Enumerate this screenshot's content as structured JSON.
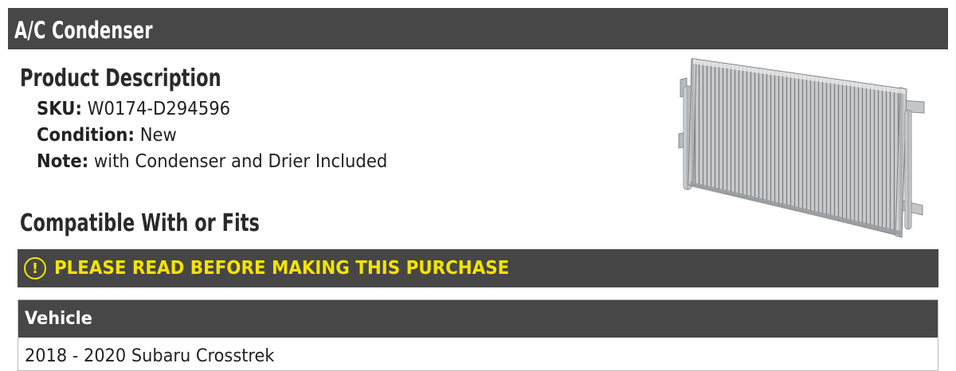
{
  "header": {
    "title": "A/C Condenser"
  },
  "description": {
    "heading": "Product Description",
    "sku_label": "SKU:",
    "sku_value": "W0174-D294596",
    "condition_label": "Condition:",
    "condition_value": "New",
    "note_label": "Note:",
    "note_value": "with Condenser and Drier Included"
  },
  "compatibility": {
    "heading": "Compatible With or Fits",
    "warning_icon": "exclamation-circle-icon",
    "warning_text": "PLEASE READ BEFORE MAKING THIS PURCHASE",
    "warning_color": "#f5e400",
    "table": {
      "column_header": "Vehicle",
      "rows": [
        "2018 - 2020 Subaru Crosstrek"
      ]
    }
  },
  "product_image": {
    "subject": "ac-condenser-part"
  }
}
